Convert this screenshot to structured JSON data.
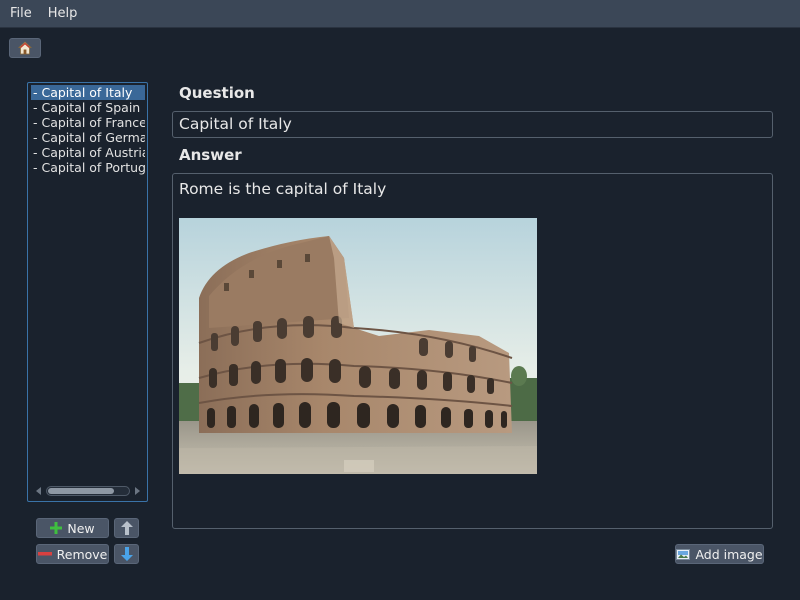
{
  "menu": {
    "file": "File",
    "help": "Help"
  },
  "toolbar": {
    "home_icon": "home-icon"
  },
  "sidebar": {
    "items": [
      {
        "label": "- Capital of Italy",
        "selected": true
      },
      {
        "label": "- Capital of Spain",
        "selected": false
      },
      {
        "label": "- Capital of France",
        "selected": false
      },
      {
        "label": "- Capital of Germany",
        "selected": false
      },
      {
        "label": "- Capital of Austria",
        "selected": false
      },
      {
        "label": "- Capital of Portugal",
        "selected": false
      }
    ],
    "scroll_position": 0.0
  },
  "buttons": {
    "new_label": "New",
    "remove_label": "Remove",
    "add_image_label": "Add image",
    "move_up_icon": "arrow-up-icon",
    "move_down_icon": "arrow-down-icon"
  },
  "editor": {
    "question_heading": "Question",
    "question_value": "Capital of Italy",
    "answer_heading": "Answer",
    "answer_text": "Rome is the capital of Italy",
    "answer_image": "colosseum-photo"
  },
  "colors": {
    "accent": "#3a6898",
    "background": "#1a222d",
    "menubar": "#3b4757",
    "new_icon": "#3fbf3f",
    "remove_icon": "#d84040",
    "arrow_icon": "#4aa3e8"
  }
}
